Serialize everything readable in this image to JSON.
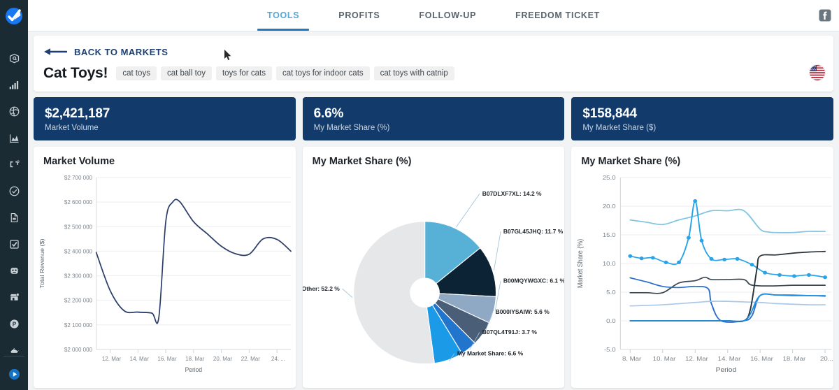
{
  "sidebar": {
    "logo_icon": "app-logo-check-icon",
    "items": [
      {
        "icon": "product-database-icon",
        "name": "product-database"
      },
      {
        "icon": "bar-chart-icon",
        "name": "sales-analytics"
      },
      {
        "icon": "globe-market-icon",
        "name": "market-research"
      },
      {
        "icon": "area-chart-icon",
        "name": "trend-report"
      },
      {
        "icon": "keyword-brackets-icon",
        "name": "keyword-scout"
      },
      {
        "icon": "check-circle-icon",
        "name": "listing-check"
      },
      {
        "icon": "document-icon",
        "name": "documents"
      },
      {
        "icon": "checkbox-icon",
        "name": "task-list"
      },
      {
        "icon": "robot-icon",
        "name": "automation"
      },
      {
        "icon": "storefront-icon",
        "name": "storefront"
      },
      {
        "icon": "profit-p-icon",
        "name": "profits"
      },
      {
        "icon": "lamp-genie-icon",
        "name": "genie"
      }
    ],
    "bottom_item": {
      "icon": "play-circle-icon",
      "name": "tutorials"
    }
  },
  "topnav": {
    "tabs": [
      {
        "label": "TOOLS",
        "active": true
      },
      {
        "label": "PROFITS",
        "active": false
      },
      {
        "label": "FOLLOW-UP",
        "active": false
      },
      {
        "label": "FREEDOM TICKET",
        "active": false
      }
    ],
    "facebook_icon": "facebook-icon"
  },
  "header": {
    "back_label": "BACK TO MARKETS",
    "back_arrow_icon": "arrow-left-icon",
    "title": "Cat Toys!",
    "tags": [
      "cat toys",
      "cat ball toy",
      "toys for cats",
      "cat toys for indoor cats",
      "cat toys with catnip"
    ],
    "marketplace_flag": "us-flag-icon"
  },
  "kpis": [
    {
      "value": "$2,421,187",
      "label": "Market Volume"
    },
    {
      "value": "6.6%",
      "label": "My Market Share (%)"
    },
    {
      "value": "$158,844",
      "label": "My Market Share ($)"
    }
  ],
  "colors": {
    "kpi_bg": "#123a6b",
    "accent_blue": "#1f7ac0",
    "tab_active": "#57a8d6",
    "sidebar_bg": "#1b2b33",
    "line_navy": "#2b3d68",
    "page_bg": "#f1f3f5"
  },
  "chart_data": [
    {
      "type": "line",
      "title": "Market Volume",
      "xlabel": "Period",
      "ylabel": "Total Revenue ($)",
      "ylim": [
        2000000,
        2700000
      ],
      "ytick_labels": [
        "$2 000 000",
        "$2 100 000",
        "$2 200 000",
        "$2 300 000",
        "$2 400 000",
        "$2 500 000",
        "$2 600 000",
        "$2 700 000"
      ],
      "yticks": [
        2000000,
        2100000,
        2200000,
        2300000,
        2400000,
        2500000,
        2600000,
        2700000
      ],
      "xtick_labels": [
        "12. Mar",
        "14. Mar",
        "16. Mar",
        "18. Mar",
        "20. Mar",
        "22. Mar",
        "24. ..."
      ],
      "grid": true,
      "series": [
        {
          "name": "Market Volume",
          "color": "#2b3d68",
          "x": [
            11,
            12,
            13,
            14,
            15,
            15.5,
            16,
            16.5,
            17,
            18,
            19,
            20,
            21,
            22,
            23,
            24,
            25
          ],
          "values": [
            2395000,
            2240000,
            2158000,
            2152000,
            2148000,
            2130000,
            2520000,
            2600000,
            2602000,
            2520000,
            2470000,
            2420000,
            2390000,
            2388000,
            2450000,
            2448000,
            2400000
          ]
        }
      ]
    },
    {
      "type": "pie",
      "title": "My Market Share (%)",
      "donut": true,
      "slices": [
        {
          "label": "B07DLXF7XL: 14.2 %",
          "name": "B07DLXF7XL",
          "value": 14.2,
          "color": "#57b0d6"
        },
        {
          "label": "B07GL45JHQ: 11.7 %",
          "name": "B07GL45JHQ",
          "value": 11.7,
          "color": "#0b2335"
        },
        {
          "label": "B00MQYWGXC: 6.1 %",
          "name": "B00MQYWGXC",
          "value": 6.1,
          "color": "#8fa8c4"
        },
        {
          "label": "B000IYSAIW: 5.6 %",
          "name": "B000IYSAIW",
          "value": 5.6,
          "color": "#4a5e78"
        },
        {
          "label": "B07QL4T91J: 3.7 %",
          "name": "B07QL4T91J",
          "value": 3.7,
          "color": "#2275cc"
        },
        {
          "label": "My Market Share: 6.6 %",
          "name": "My Market Share",
          "value": 6.6,
          "color": "#1b9ae8"
        },
        {
          "label": "Other: 52.2 %",
          "name": "Other",
          "value": 52.2,
          "color": "#e6e7e8"
        }
      ]
    },
    {
      "type": "line",
      "title": "My Market Share (%)",
      "xlabel": "Period",
      "ylabel": "Market Share (%)",
      "ylim": [
        -5.0,
        25.0
      ],
      "ytick_labels": [
        "-5.0",
        "0.0",
        "5.0",
        "10.0",
        "15.0",
        "20.0",
        "25.0"
      ],
      "yticks": [
        -5.0,
        0.0,
        5.0,
        10.0,
        15.0,
        20.0,
        25.0
      ],
      "xtick_labels": [
        "8. Mar",
        "10. Mar",
        "12. Mar",
        "14. Mar",
        "16. Mar",
        "18. Mar",
        "20..."
      ],
      "grid": true,
      "series": [
        {
          "name": "series-light-blue-top",
          "color": "#7fc4e0",
          "markers": false,
          "x": [
            8,
            9,
            10,
            11,
            12,
            13,
            14,
            15,
            16,
            16.5,
            17,
            18,
            19,
            20
          ],
          "values": [
            17.6,
            17.2,
            16.8,
            17.6,
            18.3,
            19.2,
            19.2,
            19.2,
            16.0,
            15.5,
            15.4,
            15.4,
            15.6,
            15.6
          ]
        },
        {
          "name": "series-bright-blue-markers",
          "color": "#29a3e8",
          "markers": true,
          "x": [
            8,
            8.7,
            9.4,
            10.2,
            11,
            11.6,
            12,
            12.4,
            13,
            13.8,
            14.6,
            15.5,
            16.3,
            17.2,
            18.1,
            19,
            20
          ],
          "values": [
            11.3,
            10.9,
            11.0,
            10.2,
            10.2,
            14.5,
            20.9,
            14.0,
            10.8,
            10.7,
            10.8,
            9.8,
            8.4,
            8.0,
            7.8,
            8.0,
            7.6
          ]
        },
        {
          "name": "series-dark-gray",
          "color": "#3b4750",
          "markers": false,
          "x": [
            8,
            9,
            10,
            11,
            12,
            12.6,
            13,
            14,
            15,
            15.4,
            16,
            17,
            18,
            19,
            20
          ],
          "values": [
            4.9,
            4.9,
            4.9,
            6.6,
            7.0,
            7.6,
            7.2,
            7.2,
            7.2,
            6.3,
            6.1,
            6.1,
            6.2,
            6.2,
            6.2
          ]
        },
        {
          "name": "series-medium-blue",
          "color": "#2a6fcb",
          "markers": false,
          "x": [
            8,
            9,
            10,
            11,
            12,
            12.8,
            13,
            13.6,
            15,
            15.5,
            16,
            17,
            18,
            19,
            20
          ],
          "values": [
            7.5,
            6.8,
            6.0,
            5.8,
            6.0,
            5.6,
            3.0,
            0.0,
            0.0,
            0.9,
            4.4,
            4.5,
            4.4,
            4.4,
            4.3
          ]
        },
        {
          "name": "series-pale-blue-low",
          "color": "#a8c8ea",
          "markers": false,
          "x": [
            8,
            10,
            12,
            13,
            14,
            15,
            16,
            17,
            18,
            19,
            20
          ],
          "values": [
            2.6,
            2.8,
            3.2,
            3.4,
            3.4,
            3.3,
            3.2,
            3.0,
            2.9,
            2.8,
            2.8
          ]
        },
        {
          "name": "series-black-step",
          "color": "#2a3238",
          "markers": false,
          "x": [
            8,
            10,
            12,
            14,
            15,
            15.4,
            15.8,
            16,
            17,
            18,
            19,
            20
          ],
          "values": [
            0.0,
            0.0,
            0.0,
            0.0,
            0.0,
            2.0,
            9.0,
            11.3,
            11.5,
            11.8,
            12.0,
            12.1
          ]
        },
        {
          "name": "series-azure-step",
          "color": "#1e8fe0",
          "markers": false,
          "x": [
            8,
            10,
            12,
            13.2,
            14,
            15,
            15.4,
            16,
            17,
            18,
            19,
            20
          ],
          "values": [
            0.0,
            0.0,
            0.0,
            0.0,
            0.0,
            0.0,
            1.2,
            4.4,
            4.5,
            4.5,
            4.4,
            4.4
          ]
        }
      ]
    }
  ],
  "cursor": {
    "icon": "mouse-pointer-icon"
  }
}
